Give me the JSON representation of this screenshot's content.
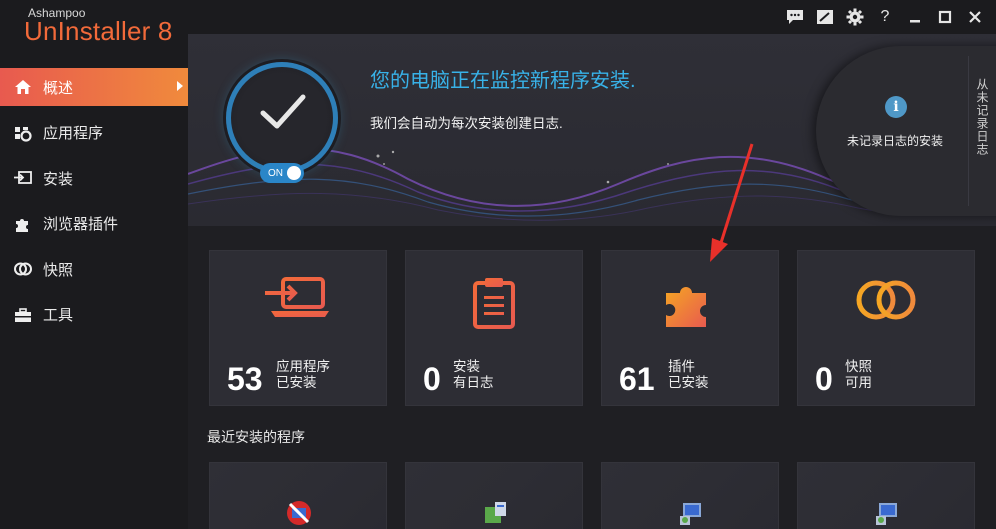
{
  "brand": {
    "small": "Ashampoo",
    "big": "UnInstaller 8"
  },
  "sidebar": {
    "items": [
      {
        "label": "概述",
        "icon": "home-icon",
        "active": true
      },
      {
        "label": "应用程序",
        "icon": "apps-icon",
        "active": false
      },
      {
        "label": "安装",
        "icon": "install-icon",
        "active": false
      },
      {
        "label": "浏览器插件",
        "icon": "puzzle-icon",
        "active": false
      },
      {
        "label": "快照",
        "icon": "snapshot-icon",
        "active": false
      },
      {
        "label": "工具",
        "icon": "toolbox-icon",
        "active": false
      }
    ]
  },
  "titlebar": {
    "buttons": [
      "chat-icon",
      "edit-icon",
      "gear-icon",
      "help-icon",
      "minimize-icon",
      "maximize-icon",
      "close-icon"
    ],
    "help_text": "?"
  },
  "hero": {
    "title": "您的电脑正在监控新程序安装.",
    "subtitle": "我们会自动为每次安装创建日志.",
    "toggle_label": "ON",
    "side_panel_label": "未记录日志的安装",
    "side_panel_icon_text": "i",
    "vertical_tab": "从未记录日志"
  },
  "cards": [
    {
      "count": "53",
      "line1": "应用程序",
      "line2": "已安装",
      "icon": "laptop-arrow-icon"
    },
    {
      "count": "0",
      "line1": "安装",
      "line2": "有日志",
      "icon": "clipboard-icon"
    },
    {
      "count": "61",
      "line1": "插件",
      "line2": "已安装",
      "icon": "puzzle-icon"
    },
    {
      "count": "0",
      "line1": "快照",
      "line2": "可用",
      "icon": "rings-icon"
    }
  ],
  "recent": {
    "title": "最近安装的程序"
  },
  "colors": {
    "accent_blue": "#38b2e8",
    "accent_orange": "#f26a3a",
    "active_gradient_start": "#e85a4f",
    "active_gradient_end": "#f08a3c"
  }
}
